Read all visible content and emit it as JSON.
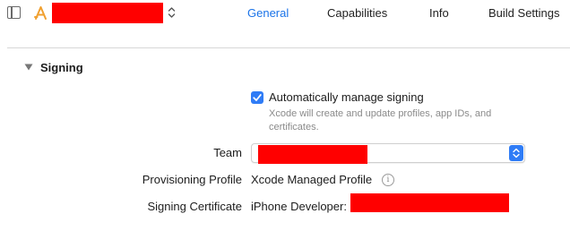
{
  "toolbar": {
    "tabs": [
      {
        "label": "General",
        "active": true
      },
      {
        "label": "Capabilities",
        "active": false
      },
      {
        "label": "Info",
        "active": false
      },
      {
        "label": "Build Settings",
        "active": false
      }
    ],
    "icons": {
      "sidebar_toggle": "sidebar-toggle-icon",
      "app": "app-store-a-icon",
      "target_chevron": "up-down-chevron-icon"
    }
  },
  "signing": {
    "section_title": "Signing",
    "auto_manage": {
      "label": "Automatically manage signing",
      "checked": true,
      "help": "Xcode will create and update profiles, app IDs, and certificates."
    },
    "team": {
      "label": "Team"
    },
    "provisioning_profile": {
      "label": "Provisioning Profile",
      "value": "Xcode Managed Profile"
    },
    "signing_certificate": {
      "label": "Signing Certificate",
      "value": "iPhone Developer:"
    }
  },
  "colors": {
    "accent": "#2f7cf6",
    "active_tab": "#1a73e8",
    "redaction": "#ff0000",
    "help_text": "#8a8a8a"
  }
}
